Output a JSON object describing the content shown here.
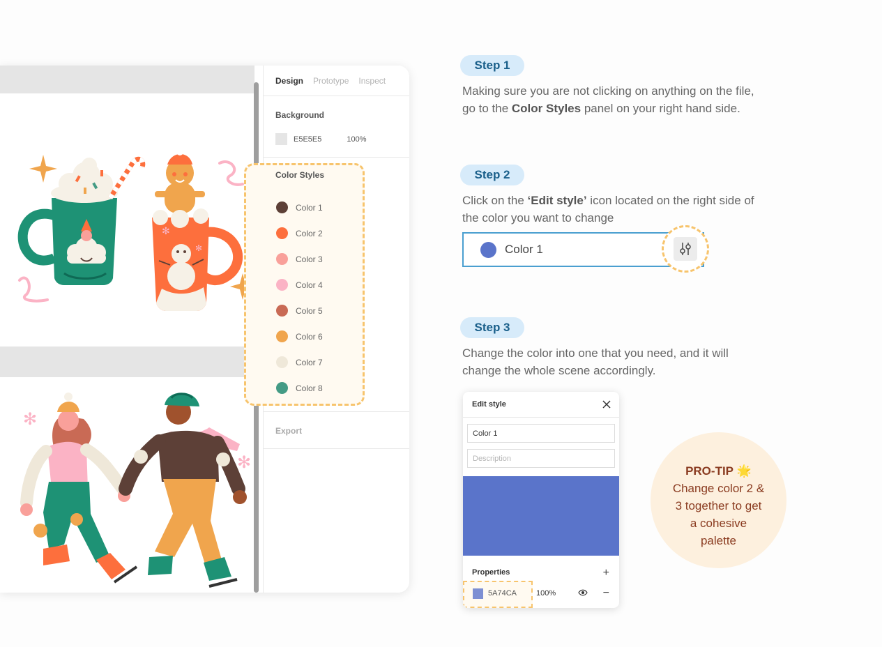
{
  "panel": {
    "tabs": [
      {
        "label": "Design",
        "active": true
      },
      {
        "label": "Prototype",
        "active": false
      },
      {
        "label": "Inspect",
        "active": false
      }
    ],
    "background": {
      "title": "Background",
      "hex": "E5E5E5",
      "opacity": "100%",
      "color": "#e5e5e5"
    },
    "color_styles": {
      "title": "Color Styles",
      "items": [
        {
          "label": "Color 1",
          "color": "#5d4037"
        },
        {
          "label": "Color 2",
          "color": "#fd6f3d"
        },
        {
          "label": "Color 3",
          "color": "#f9a09a"
        },
        {
          "label": "Color 4",
          "color": "#fbb3c5"
        },
        {
          "label": "Color 5",
          "color": "#c96a55"
        },
        {
          "label": "Color 6",
          "color": "#f0a54d"
        },
        {
          "label": "Color 7",
          "color": "#efe8d9"
        },
        {
          "label": "Color 8",
          "color": "#449b85"
        }
      ]
    },
    "export": {
      "title": "Export"
    }
  },
  "steps": [
    {
      "pill": "Step 1",
      "text_before": "Making sure you are not clicking on anything on the file, go to the ",
      "bold": "Color Styles",
      "text_after": " panel on your right hand side."
    },
    {
      "pill": "Step 2",
      "text_before": "Click on the ",
      "bold": "‘Edit style’",
      "text_after": " icon located on the right side of the color you want to change"
    },
    {
      "pill": "Step 3",
      "text_before": "Change the color into one that you need, and it will change the whole scene accordingly.",
      "bold": "",
      "text_after": ""
    }
  ],
  "color_row": {
    "label": "Color 1",
    "color": "#5a74ca",
    "icon": "edit-style-icon"
  },
  "edit_style": {
    "title": "Edit style",
    "name_value": "Color 1",
    "description_placeholder": "Description",
    "preview_color": "#5a74ca",
    "properties_title": "Properties",
    "hex": "5A74CA",
    "opacity": "100%",
    "swatch_color": "#7d8fd3"
  },
  "protip": {
    "title": "PRO-TIP",
    "emoji": "🌟",
    "text": "Change color 2 & 3 together to get a cohesive palette"
  }
}
